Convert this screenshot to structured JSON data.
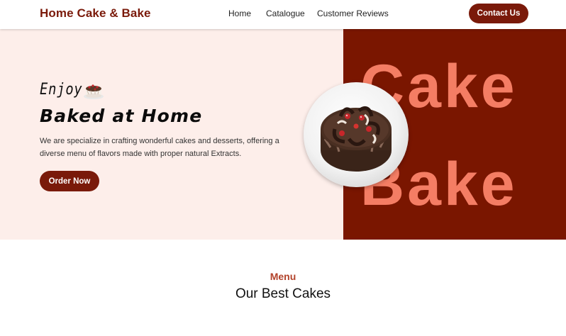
{
  "nav": {
    "brand": "Home Cake & Bake",
    "links": [
      "Home",
      "Catalogue",
      "Customer Reviews"
    ],
    "contact_label": "Contact Us"
  },
  "hero": {
    "enjoy": "Enjoy",
    "title": "Baked at Home",
    "description": "We are specialize in crafting wonderful cakes and desserts, offering a diverse menu of flavors made with proper natural Extracts.",
    "order_label": "Order Now",
    "big_text": [
      "Cake",
      "&",
      "Bake"
    ]
  },
  "menu": {
    "kicker": "Menu",
    "title": "Our Best Cakes"
  },
  "colors": {
    "brand": "#7a1a0a",
    "hero_left_bg": "#fdeeea",
    "hero_right_bg": "#7a1600",
    "big_text": "#f47d64",
    "menu_kicker": "#b2422a"
  }
}
